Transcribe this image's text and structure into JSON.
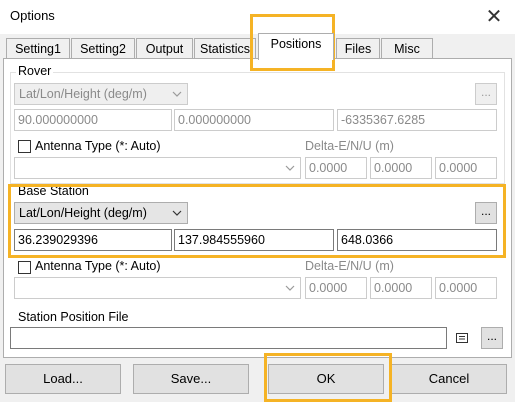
{
  "window": {
    "title": "Options",
    "close_glyph": "✕"
  },
  "tabs": [
    {
      "label": "Setting1"
    },
    {
      "label": "Setting2"
    },
    {
      "label": "Output"
    },
    {
      "label": "Statistics"
    },
    {
      "label": "Positions",
      "active": true
    },
    {
      "label": "Files"
    },
    {
      "label": "Misc"
    }
  ],
  "rover": {
    "group_label": "Rover",
    "format_select": "Lat/Lon/Height (deg/m)",
    "browse_label": "...",
    "position": [
      "90.000000000",
      "0.000000000",
      "-6335367.6285"
    ],
    "antenna_label": "Antenna Type (*: Auto)",
    "antenna_select": "",
    "delta_label": "Delta-E/N/U (m)",
    "delta": [
      "0.0000",
      "0.0000",
      "0.0000"
    ]
  },
  "base": {
    "group_label": "Base Station",
    "format_select": "Lat/Lon/Height (deg/m)",
    "browse_label": "...",
    "position": [
      "36.239029396",
      "137.984555960",
      "648.0366"
    ],
    "antenna_label": "Antenna Type (*: Auto)",
    "antenna_select": "",
    "delta_label": "Delta-E/N/U (m)",
    "delta": [
      "0.0000",
      "0.0000",
      "0.0000"
    ]
  },
  "station_file": {
    "label": "Station Position File",
    "value": "",
    "browse_label": "..."
  },
  "buttons": {
    "load": "Load...",
    "save": "Save...",
    "ok": "OK",
    "cancel": "Cancel"
  },
  "highlight_color": "#f5b325"
}
